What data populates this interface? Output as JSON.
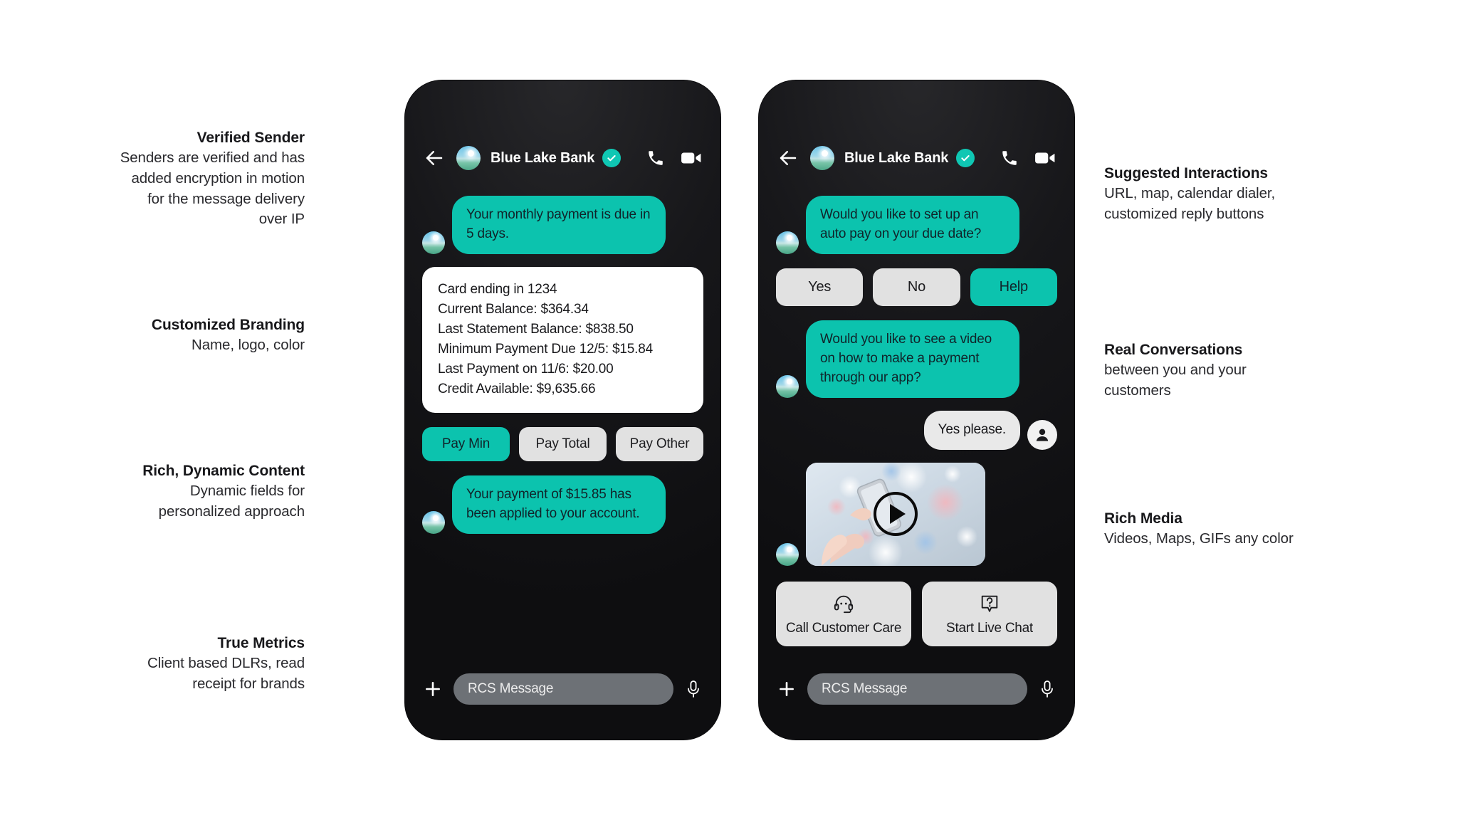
{
  "page": {
    "background": "#ffffff",
    "brand_teal": "#0cc3ae",
    "phone_bg": "#111113",
    "chip_gray": "#e1e1e1"
  },
  "annotations": {
    "left": [
      {
        "title": "Verified Sender",
        "body": "Senders are verified and has added encryption in motion for the message delivery over IP"
      },
      {
        "title": "Customized Branding",
        "body": "Name, logo, color"
      },
      {
        "title": "Rich, Dynamic Content",
        "body": "Dynamic fields for personalized approach"
      },
      {
        "title": "True Metrics",
        "body": "Client based DLRs, read receipt for brands"
      }
    ],
    "right": [
      {
        "title": "Suggested Interactions",
        "body": "URL, map, calendar dialer, customized reply buttons"
      },
      {
        "title": "Real Conversations",
        "body": "between you and your customers"
      },
      {
        "title": "Rich Media",
        "body": "Videos, Maps, GIFs any color"
      }
    ]
  },
  "phone_left": {
    "header": {
      "back_icon": "arrow-left-icon",
      "avatar_icon": "brand-avatar",
      "name": "Blue Lake Bank",
      "verified_icon": "verified-check-icon",
      "call_icon": "phone-icon",
      "video_icon": "video-camera-icon"
    },
    "messages": {
      "bubble_1": "Your monthly payment is due in 5 days.",
      "card_lines": [
        "Card ending in 1234",
        "Current Balance: $364.34",
        "Last Statement Balance: $838.50",
        "Minimum Payment Due 12/5: $15.84",
        "Last Payment on 11/6: $20.00",
        "Credit Available: $9,635.66"
      ],
      "pay_chips": [
        {
          "label": "Pay Min",
          "style": "teal"
        },
        {
          "label": "Pay Total",
          "style": "gray"
        },
        {
          "label": "Pay Other",
          "style": "gray"
        }
      ],
      "bubble_2": "Your payment of $15.85 has been applied to your account."
    },
    "composer": {
      "plus_icon": "plus-icon",
      "placeholder": "RCS Message",
      "mic_icon": "microphone-icon"
    }
  },
  "phone_right": {
    "header": {
      "back_icon": "arrow-left-icon",
      "avatar_icon": "brand-avatar",
      "name": "Blue Lake Bank",
      "verified_icon": "verified-check-icon",
      "call_icon": "phone-icon",
      "video_icon": "video-camera-icon"
    },
    "messages": {
      "bubble_1": "Would you like to set up an auto pay on your due date?",
      "reply_chips": [
        {
          "label": "Yes",
          "style": "gray"
        },
        {
          "label": "No",
          "style": "gray"
        },
        {
          "label": "Help",
          "style": "teal"
        }
      ],
      "bubble_2": "Would you like to see a video on how to make a payment through our app?",
      "user_reply": "Yes please.",
      "video": {
        "alt": "hands holding a smartphone with bokeh lights",
        "play_icon": "play-button-icon"
      },
      "action_cards": [
        {
          "label": "Call Customer Care",
          "icon": "headset-support-icon"
        },
        {
          "label": "Start Live Chat",
          "icon": "question-chat-icon"
        }
      ]
    },
    "composer": {
      "plus_icon": "plus-icon",
      "placeholder": "RCS Message",
      "mic_icon": "microphone-icon"
    }
  }
}
